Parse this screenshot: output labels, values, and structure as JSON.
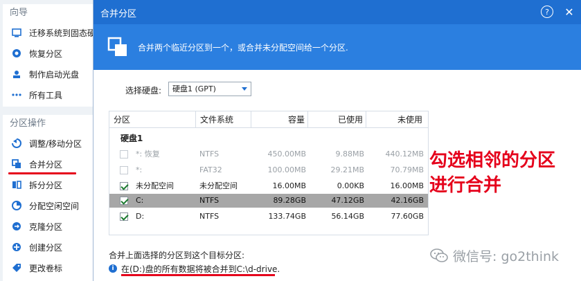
{
  "sidebar": {
    "wizard_title": "向导",
    "wizard_items": [
      {
        "label": "迁移系统到固态硬盘",
        "icon": "migrate-icon"
      },
      {
        "label": "恢复分区",
        "icon": "recover-icon"
      },
      {
        "label": "制作启动光盘",
        "icon": "bootdisk-icon"
      },
      {
        "label": "所有工具",
        "icon": "tools-icon"
      }
    ],
    "partition_title": "分区操作",
    "partition_items": [
      {
        "label": "调整/移动分区",
        "icon": "resize-icon"
      },
      {
        "label": "合并分区",
        "icon": "merge-icon"
      },
      {
        "label": "拆分分区",
        "icon": "split-icon"
      },
      {
        "label": "分配空闲空间",
        "icon": "allocate-icon"
      },
      {
        "label": "克隆分区",
        "icon": "clone-icon"
      },
      {
        "label": "创建分区",
        "icon": "create-icon"
      },
      {
        "label": "更改卷标",
        "icon": "label-icon"
      }
    ]
  },
  "dialog": {
    "title": "合并分区",
    "help": "?",
    "close": "✕",
    "banner_text": "合并两个临近分区到一个，或合并未分配空间给一个分区.",
    "disk_label": "选择硬盘:",
    "disk_value": "硬盘1 (GPT)",
    "columns": [
      "分区",
      "文件系统",
      "容量",
      "已使用",
      "未使用"
    ],
    "disk_row": "硬盘1",
    "rows": [
      {
        "name": "*: 恢复",
        "fs": "NTFS",
        "capacity": "450.00MB",
        "used": "9.88MB",
        "free": "440.12MB",
        "checked": false,
        "enabled": false
      },
      {
        "name": "*:",
        "fs": "FAT32",
        "capacity": "100.00MB",
        "used": "29.21MB",
        "free": "70.79MB",
        "checked": false,
        "enabled": false
      },
      {
        "name": "未分配空间",
        "fs": "未分配空间",
        "capacity": "16.00MB",
        "used": "0.00KB",
        "free": "16.00MB",
        "checked": true,
        "enabled": true
      },
      {
        "name": "C:",
        "fs": "NTFS",
        "capacity": "89.28GB",
        "used": "47.12GB",
        "free": "42.16GB",
        "checked": true,
        "enabled": true
      },
      {
        "name": "D:",
        "fs": "NTFS",
        "capacity": "133.74GB",
        "used": "56.14GB",
        "free": "77.60GB",
        "checked": true,
        "enabled": true
      }
    ],
    "merge_target_label": "合并上面选择的分区到这个目标分区:",
    "info_text": "在(D:)盘的所有数据将被合并到C:\\d-drive."
  },
  "annotation": {
    "line1": "勾选相邻的分区",
    "line2": "进行合并"
  },
  "watermark": {
    "text": "微信号: go2think"
  },
  "colors": {
    "accent": "#1f6fd1",
    "banner": "#2b7fe0",
    "annotation": "#e5001b",
    "selected_row": "#a7a7a7"
  }
}
